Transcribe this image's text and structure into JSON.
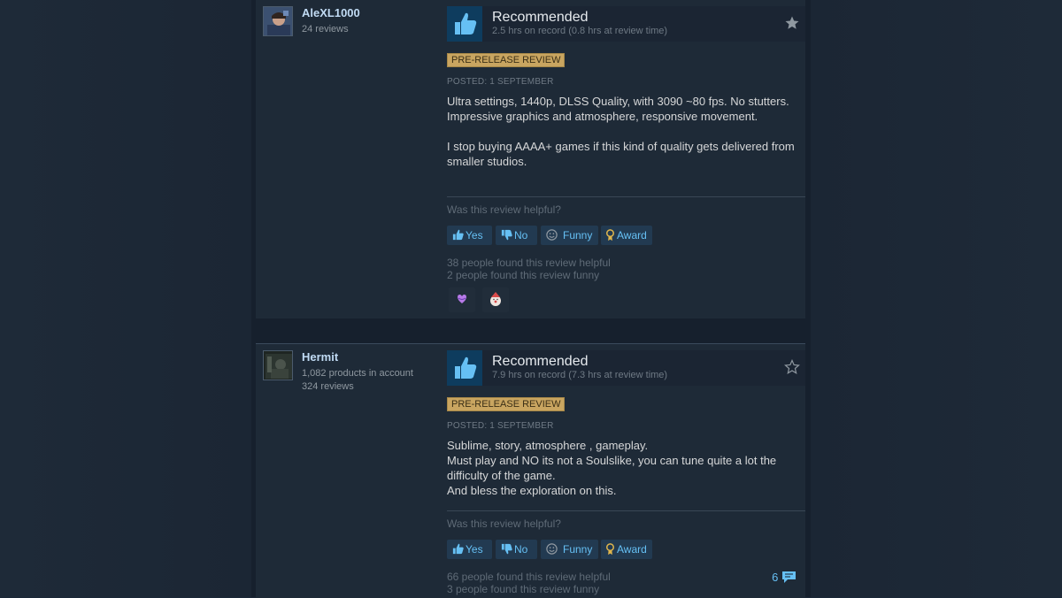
{
  "reviews": [
    {
      "author": {
        "name": "AleXL1000",
        "meta1": "24 reviews",
        "meta2": ""
      },
      "verdict": "Recommended",
      "hours": "2.5 hrs on record (0.8 hrs at review time)",
      "badge": "PRE-RELEASE REVIEW",
      "posted": "POSTED: 1 SEPTEMBER",
      "body": [
        "Ultra settings, 1440p, DLSS Quality, with 3090 ~80 fps. No stutters. Impressive graphics and atmosphere, responsive movement.",
        "I stop buying AAAA+ games if this kind of quality gets delivered from smaller studios."
      ],
      "helpful_question": "Was this review helpful?",
      "buttons": {
        "yes": "Yes",
        "no": "No",
        "funny": "Funny",
        "award": "Award"
      },
      "helpful_count": "38 people found this review helpful",
      "funny_count": "2 people found this review funny",
      "star_filled": true,
      "awards": [
        "heart-award-icon",
        "clown-award-icon"
      ]
    },
    {
      "author": {
        "name": "Hermit",
        "meta1": "1,082 products in account",
        "meta2": "324 reviews"
      },
      "verdict": "Recommended",
      "hours": "7.9 hrs on record (7.3 hrs at review time)",
      "badge": "PRE-RELEASE REVIEW",
      "posted": "POSTED: 1 SEPTEMBER",
      "body": [
        "Sublime, story, atmosphere , gameplay.",
        "Must play and NO its not a Soulslike, you can tune quite a lot the difficulty of the game.",
        "And bless the exploration on this."
      ],
      "helpful_question": "Was this review helpful?",
      "buttons": {
        "yes": "Yes",
        "no": "No",
        "funny": "Funny",
        "award": "Award"
      },
      "helpful_count": "66 people found this review helpful",
      "funny_count": "3 people found this review funny",
      "star_filled": false,
      "comment_count": "6"
    }
  ],
  "colors": {
    "link": "#66c0f4",
    "badge": "#c9a560",
    "background": "#1b2838"
  }
}
